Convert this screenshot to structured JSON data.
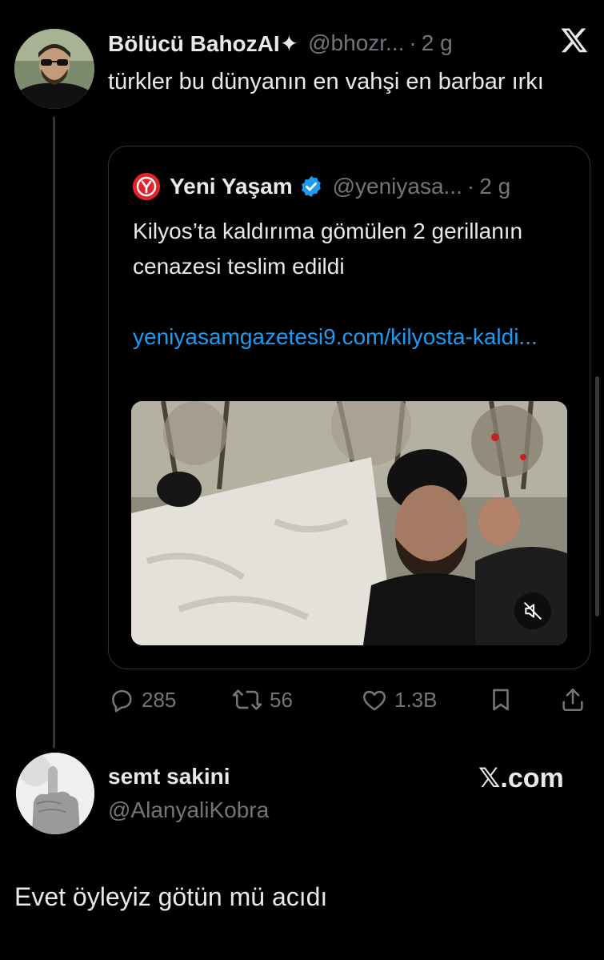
{
  "tweet": {
    "author_name": "Bölücü BahozAI✦",
    "handle": "@bhozr...",
    "separator": "·",
    "time": "2 g",
    "text": "türkler bu dünyanın en vahşi en barbar ırkı"
  },
  "quote": {
    "author_name": "Yeni Yaşam",
    "handle": "@yeniyasa...",
    "separator": "·",
    "time": "2 g",
    "text": "Kilyos’ta kaldırıma gömülen 2 gerillanın cenazesi teslim edildi",
    "link": "yeniyasamgazetesi9.com/kilyosta-kaldi..."
  },
  "actions": {
    "replies": "285",
    "reposts": "56",
    "likes": "1.3B"
  },
  "reply": {
    "name": "semt sakini",
    "handle": "@AlanyaliKobra",
    "source": "𝕏.com",
    "text": "Evet öyleyiz götün mü acıdı"
  },
  "colors": {
    "background": "#000000",
    "text": "#e7e9ea",
    "muted": "#71767b",
    "link": "#1d9bf0",
    "border": "#2f3336",
    "brand_red": "#e0242b"
  },
  "icons": [
    "x-logo-icon",
    "verified-badge-icon",
    "mute-icon",
    "reply-icon",
    "repost-icon",
    "like-icon",
    "bookmark-icon",
    "share-icon"
  ]
}
